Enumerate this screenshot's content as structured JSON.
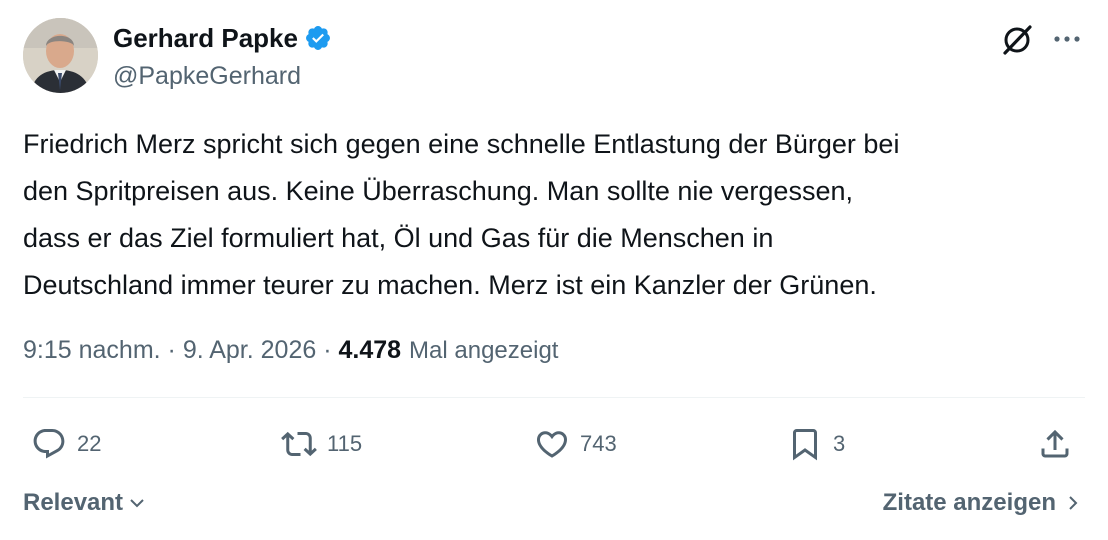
{
  "author": {
    "display_name": "Gerhard Papke",
    "handle": "@PapkeGerhard",
    "verified": true
  },
  "tweet": {
    "text": "Friedrich Merz spricht sich gegen eine schnelle Entlastung der Bürger bei\nden Spritpreisen aus. Keine Überraschung. Man sollte nie vergessen,\ndass er das Ziel formuliert hat, Öl und Gas für die Menschen in\nDeutschland immer teurer zu machen. Merz ist ein Kanzler der Grünen.",
    "time": "9:15 nachm.",
    "separator": " · ",
    "date": "9. Apr. 2026",
    "views_count": "4.478",
    "views_label": "Mal angezeigt"
  },
  "actions": {
    "replies": "22",
    "retweets": "115",
    "likes": "743",
    "bookmarks": "3"
  },
  "footer": {
    "sort_label": "Relevant",
    "quotes_label": "Zitate anzeigen"
  },
  "colors": {
    "verified_blue": "#1d9bf0",
    "text_primary": "#0f1419",
    "text_secondary": "#536471",
    "divider": "#eff3f4"
  },
  "icons": [
    "verified-badge-icon",
    "grok-icon",
    "more-icon",
    "reply-icon",
    "retweet-icon",
    "like-icon",
    "bookmark-icon",
    "share-icon",
    "chevron-down-icon",
    "chevron-right-icon"
  ]
}
